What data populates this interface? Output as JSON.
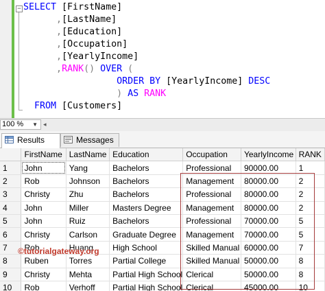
{
  "editor": {
    "collapse_glyph": "−",
    "lines": [
      [
        {
          "t": "SELECT ",
          "c": "kw"
        },
        {
          "t": "[FirstName]",
          "c": "tx"
        }
      ],
      [
        {
          "t": "      ",
          "c": "tx"
        },
        {
          "t": ",",
          "c": "gr"
        },
        {
          "t": "[LastName]",
          "c": "tx"
        }
      ],
      [
        {
          "t": "      ",
          "c": "tx"
        },
        {
          "t": ",",
          "c": "gr"
        },
        {
          "t": "[Education]",
          "c": "tx"
        }
      ],
      [
        {
          "t": "      ",
          "c": "tx"
        },
        {
          "t": ",",
          "c": "gr"
        },
        {
          "t": "[Occupation]",
          "c": "tx"
        }
      ],
      [
        {
          "t": "      ",
          "c": "tx"
        },
        {
          "t": ",",
          "c": "gr"
        },
        {
          "t": "[YearlyIncome]",
          "c": "tx"
        }
      ],
      [
        {
          "t": "      ",
          "c": "tx"
        },
        {
          "t": ",",
          "c": "gr"
        },
        {
          "t": "RANK",
          "c": "fn"
        },
        {
          "t": "() ",
          "c": "gr"
        },
        {
          "t": "OVER ",
          "c": "kw"
        },
        {
          "t": "(",
          "c": "gr"
        }
      ],
      [
        {
          "t": "                 ",
          "c": "tx"
        },
        {
          "t": "ORDER BY ",
          "c": "kw"
        },
        {
          "t": "[YearlyIncome] ",
          "c": "tx"
        },
        {
          "t": "DESC",
          "c": "kw"
        }
      ],
      [
        {
          "t": "                 ",
          "c": "tx"
        },
        {
          "t": ") ",
          "c": "gr"
        },
        {
          "t": "AS ",
          "c": "kw"
        },
        {
          "t": "RANK",
          "c": "fn"
        }
      ],
      [
        {
          "t": "  ",
          "c": "tx"
        },
        {
          "t": "FROM ",
          "c": "kw"
        },
        {
          "t": "[Customers]",
          "c": "tx"
        }
      ]
    ]
  },
  "zoom": {
    "value": "100 %",
    "arrow": "▼",
    "scroll_left": "◂"
  },
  "tabs": [
    {
      "label": "Results",
      "icon": "grid-icon",
      "active": true
    },
    {
      "label": "Messages",
      "icon": "message-icon",
      "active": false
    }
  ],
  "grid": {
    "columns": [
      "",
      "FirstName",
      "LastName",
      "Education",
      "Occupation",
      "YearlyIncome",
      "RANK"
    ],
    "rows": [
      [
        "1",
        "John",
        "Yang",
        "Bachelors",
        "Professional",
        "90000.00",
        "1"
      ],
      [
        "2",
        "Rob",
        "Johnson",
        "Bachelors",
        "Management",
        "80000.00",
        "2"
      ],
      [
        "3",
        "Christy",
        "Zhu",
        "Bachelors",
        "Professional",
        "80000.00",
        "2"
      ],
      [
        "4",
        "John",
        "Miller",
        "Masters Degree",
        "Management",
        "80000.00",
        "2"
      ],
      [
        "5",
        "John",
        "Ruiz",
        "Bachelors",
        "Professional",
        "70000.00",
        "5"
      ],
      [
        "6",
        "Christy",
        "Carlson",
        "Graduate Degree",
        "Management",
        "70000.00",
        "5"
      ],
      [
        "7",
        "Rob",
        "Huang",
        "High School",
        "Skilled Manual",
        "60000.00",
        "7"
      ],
      [
        "8",
        "Ruben",
        "Torres",
        "Partial College",
        "Skilled Manual",
        "50000.00",
        "8"
      ],
      [
        "9",
        "Christy",
        "Mehta",
        "Partial High School",
        "Clerical",
        "50000.00",
        "8"
      ],
      [
        "10",
        "Rob",
        "Verhoff",
        "Partial High School",
        "Clerical",
        "45000.00",
        "10"
      ]
    ]
  },
  "watermark": "©tutorialgateway.org",
  "colors": {
    "keyword": "#0000ff",
    "function": "#ff00ff",
    "operator": "#808080",
    "highlight_border": "#a43a3a",
    "watermark": "#c0392b"
  }
}
